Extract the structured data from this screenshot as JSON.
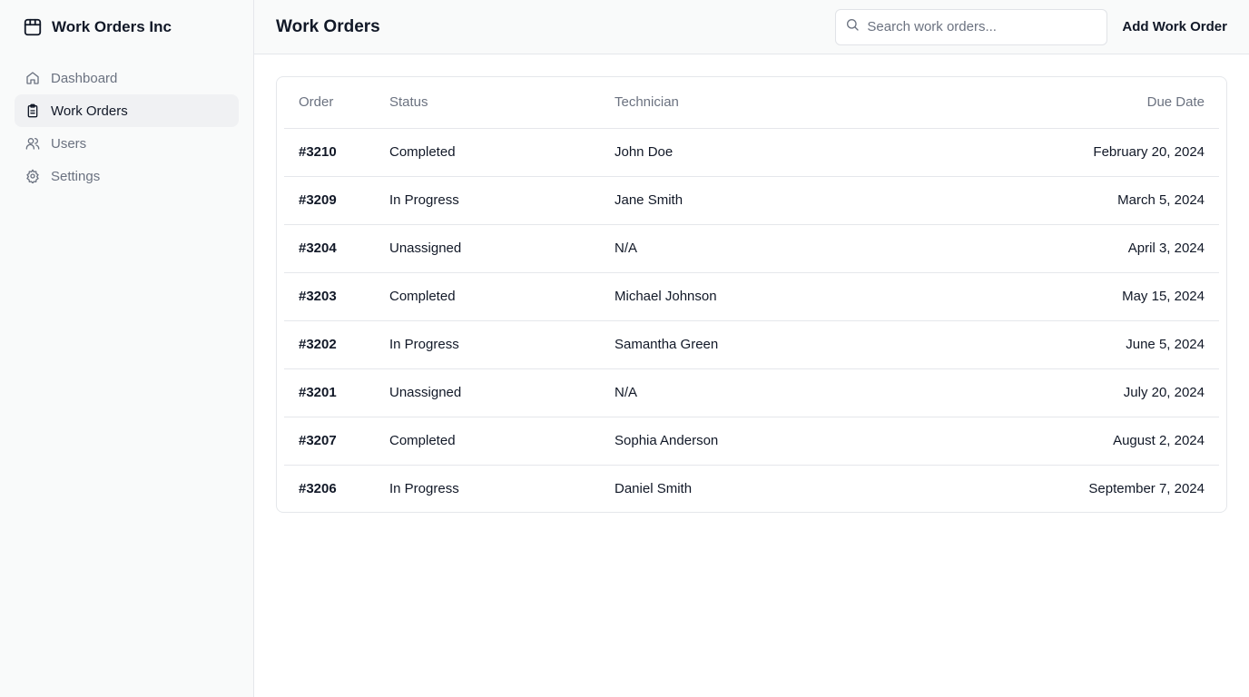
{
  "brand": {
    "name": "Work Orders Inc",
    "icon": "package-icon"
  },
  "nav": [
    {
      "label": "Dashboard",
      "icon": "home-icon",
      "active": false
    },
    {
      "label": "Work Orders",
      "icon": "clipboard-icon",
      "active": true
    },
    {
      "label": "Users",
      "icon": "users-icon",
      "active": false
    },
    {
      "label": "Settings",
      "icon": "gear-icon",
      "active": false
    }
  ],
  "header": {
    "title": "Work Orders",
    "search_placeholder": "Search work orders...",
    "add_label": "Add Work Order"
  },
  "table": {
    "columns": [
      "Order",
      "Status",
      "Technician",
      "Due Date"
    ],
    "rows": [
      {
        "order": "#3210",
        "status": "Completed",
        "technician": "John Doe",
        "due": "February 20, 2024"
      },
      {
        "order": "#3209",
        "status": "In Progress",
        "technician": "Jane Smith",
        "due": "March 5, 2024"
      },
      {
        "order": "#3204",
        "status": "Unassigned",
        "technician": "N/A",
        "due": "April 3, 2024"
      },
      {
        "order": "#3203",
        "status": "Completed",
        "technician": "Michael Johnson",
        "due": "May 15, 2024"
      },
      {
        "order": "#3202",
        "status": "In Progress",
        "technician": "Samantha Green",
        "due": "June 5, 2024"
      },
      {
        "order": "#3201",
        "status": "Unassigned",
        "technician": "N/A",
        "due": "July 20, 2024"
      },
      {
        "order": "#3207",
        "status": "Completed",
        "technician": "Sophia Anderson",
        "due": "August 2, 2024"
      },
      {
        "order": "#3206",
        "status": "In Progress",
        "technician": "Daniel Smith",
        "due": "September 7, 2024"
      }
    ]
  }
}
